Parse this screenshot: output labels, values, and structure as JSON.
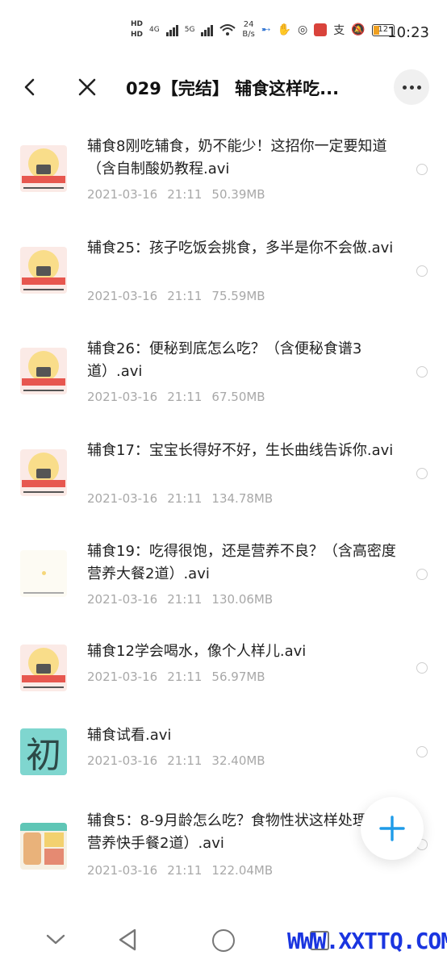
{
  "status_bar": {
    "hd_top": "HD",
    "hd_bottom": "HD",
    "net1": "4G",
    "net2": "5G",
    "speed_value": "24",
    "speed_unit": "B/s",
    "battery": "12",
    "time": "10:23",
    "icons": [
      "nfc-icon",
      "hand-icon",
      "ring-icon",
      "app-icon",
      "alipay-icon",
      "mute-icon"
    ]
  },
  "header": {
    "title": "029【完结】 辅食这样吃..."
  },
  "files": [
    {
      "name": "辅食8刚吃辅食，奶不能少！这招你一定要知道（含自制酸奶教程.avi",
      "date": "2021-03-16",
      "time": "21:11",
      "size": "50.39MB",
      "thumb": "cake"
    },
    {
      "name": "辅食25：孩子吃饭会挑食，多半是你不会做.avi",
      "date": "2021-03-16",
      "time": "21:11",
      "size": "75.59MB",
      "thumb": "cake"
    },
    {
      "name": "辅食26：便秘到底怎么吃？（含便秘食谱3道）.avi",
      "date": "2021-03-16",
      "time": "21:11",
      "size": "67.50MB",
      "thumb": "cake"
    },
    {
      "name": "辅食17：宝宝长得好不好，生长曲线告诉你.avi",
      "date": "2021-03-16",
      "time": "21:11",
      "size": "134.78MB",
      "thumb": "cake"
    },
    {
      "name": "辅食19：吃得很饱，还是营养不良？（含高密度营养大餐2道）.avi",
      "date": "2021-03-16",
      "time": "21:11",
      "size": "130.06MB",
      "thumb": "pale"
    },
    {
      "name": "辅食12学会喝水，像个人样儿.avi",
      "date": "2021-03-16",
      "time": "21:11",
      "size": "56.97MB",
      "thumb": "cake"
    },
    {
      "name": "辅食试看.avi",
      "date": "2021-03-16",
      "time": "21:11",
      "size": "32.40MB",
      "thumb": "char",
      "thumb_char": "初"
    },
    {
      "name": "辅食5：8-9月龄怎么吃？食物性状这样处理（含营养快手餐2道）.avi",
      "date": "2021-03-16",
      "time": "21:11",
      "size": "122.04MB",
      "thumb": "food"
    }
  ],
  "watermark": "WWW.XXTTQ.COM",
  "colors": {
    "accent": "#1e9be8",
    "meta_text": "#a8a8a8",
    "watermark": "#1a35e0"
  }
}
